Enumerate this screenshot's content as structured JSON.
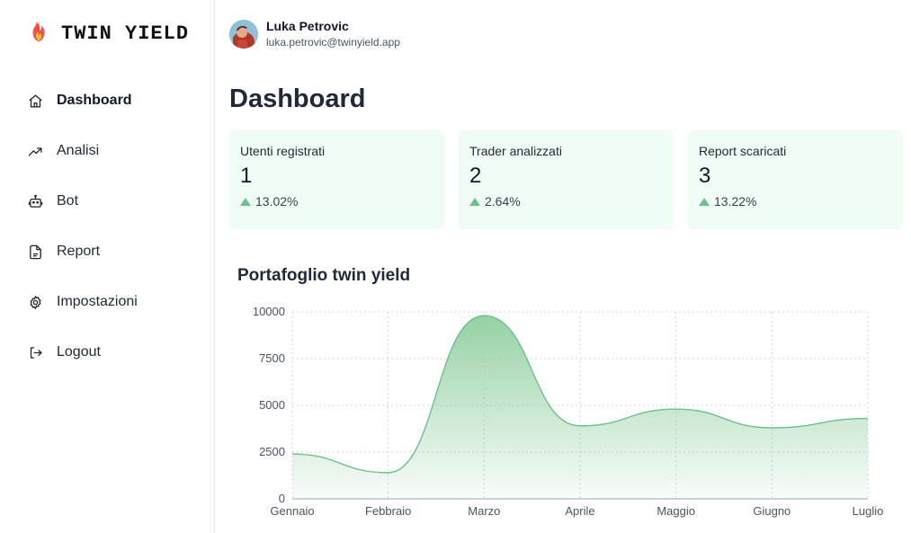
{
  "brand": {
    "name": "TWIN YIELD",
    "logo_icon": "flame-icon"
  },
  "nav": [
    {
      "label": "Dashboard",
      "icon": "home-icon",
      "active": true
    },
    {
      "label": "Analisi",
      "icon": "trending-up-icon"
    },
    {
      "label": "Bot",
      "icon": "bot-icon"
    },
    {
      "label": "Report",
      "icon": "file-icon"
    },
    {
      "label": "Impostazioni",
      "icon": "gear-icon"
    },
    {
      "label": "Logout",
      "icon": "logout-icon"
    }
  ],
  "user": {
    "name": "Luka Petrovic",
    "email": "luka.petrovic@twinyield.app"
  },
  "page": {
    "title": "Dashboard"
  },
  "cards": [
    {
      "title": "Utenti registrati",
      "value": "1",
      "change": "13.02%",
      "trend": "up"
    },
    {
      "title": "Trader analizzati",
      "value": "2",
      "change": "2.64%",
      "trend": "up"
    },
    {
      "title": "Report scaricati",
      "value": "3",
      "change": "13.22%",
      "trend": "up"
    }
  ],
  "colors": {
    "accent": "#6cc08b",
    "card_bg": "#f0fdf4",
    "area_fill": "#a7d8b5"
  },
  "chart": {
    "title": "Portafoglio twin yield"
  },
  "chart_data": {
    "type": "area",
    "title": "Portafoglio twin yield",
    "categories": [
      "Gennaio",
      "Febbraio",
      "Marzo",
      "Aprile",
      "Maggio",
      "Giugno",
      "Luglio"
    ],
    "values": [
      2400,
      1400,
      9800,
      3900,
      4800,
      3800,
      4300
    ],
    "yticks": [
      0,
      2500,
      5000,
      7500,
      10000
    ],
    "ylim": [
      0,
      10000
    ],
    "grid": true,
    "smooth": true
  }
}
